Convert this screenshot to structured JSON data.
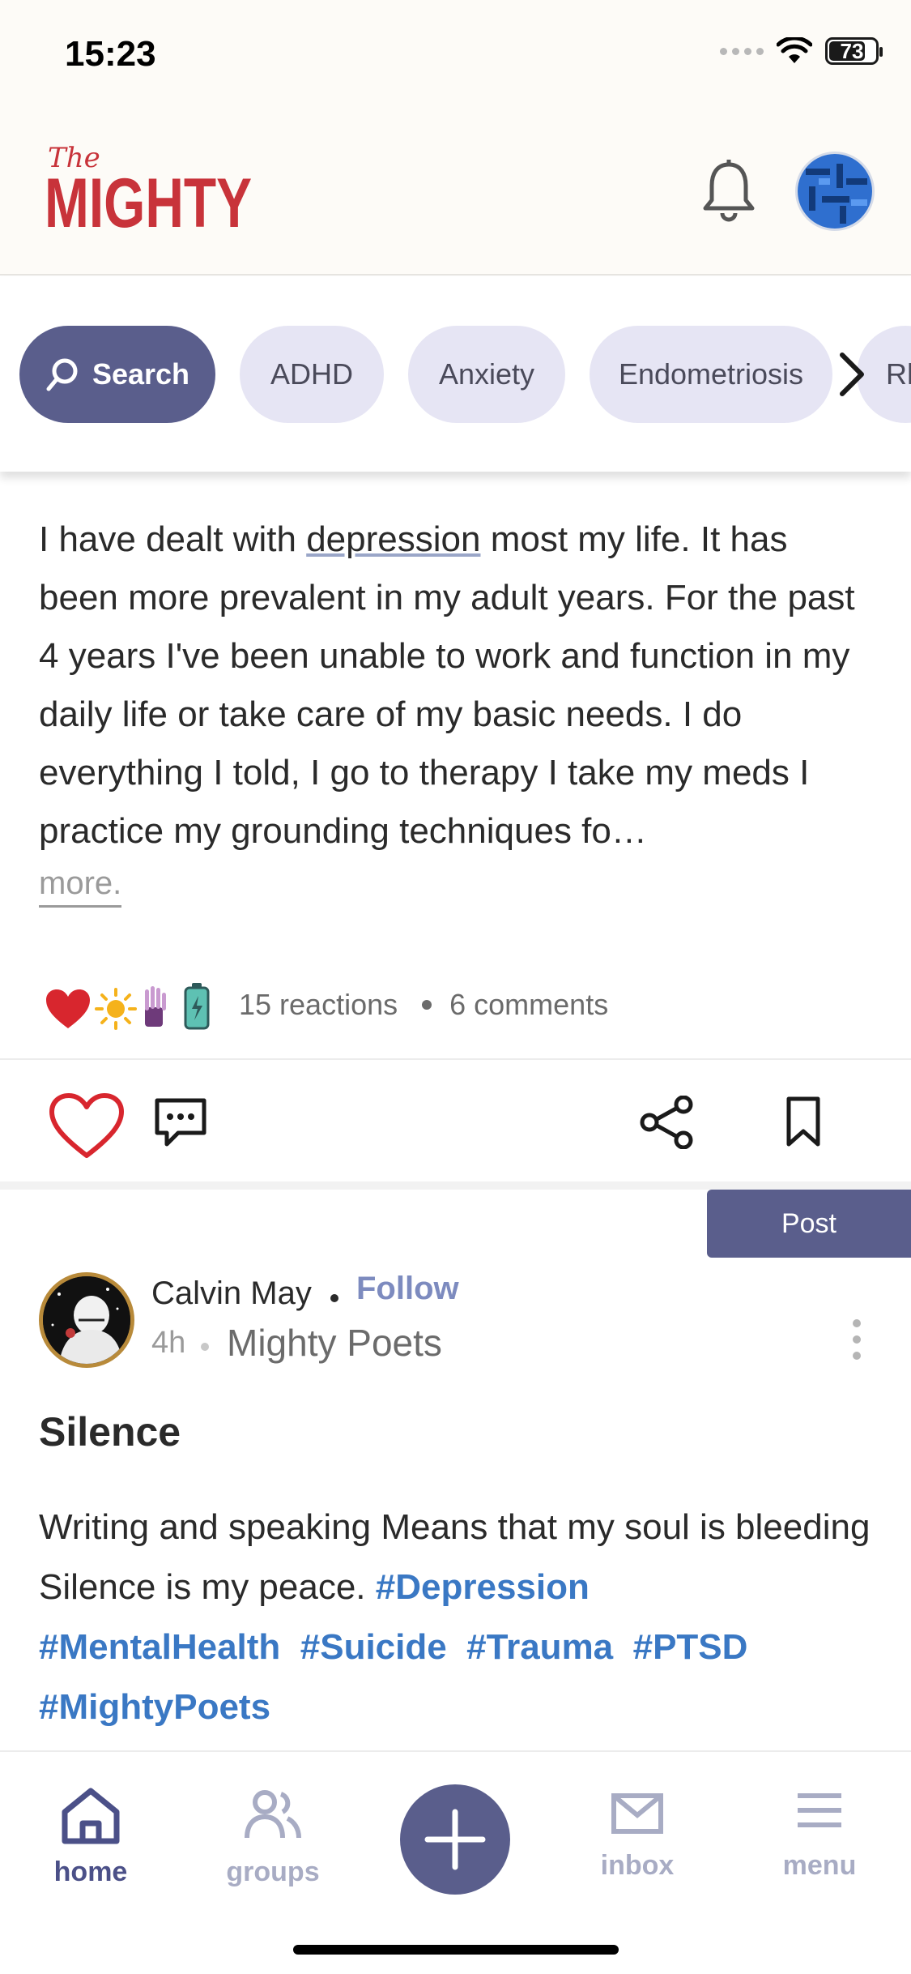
{
  "status_bar": {
    "time": "15:23",
    "battery": "73",
    "battery_level": 0.73
  },
  "header": {
    "logo_small": "The",
    "logo_main": "MIGHTY"
  },
  "chips": [
    {
      "label": "Search"
    },
    {
      "label": "ADHD"
    },
    {
      "label": "Anxiety"
    },
    {
      "label": "Endometriosis"
    },
    {
      "label": "Rh"
    }
  ],
  "post1": {
    "body_before_link": "I have dealt with ",
    "body_link": "depression",
    "body_after_link": " most my life. It has been more prevalent in my adult years. For the past 4 years I've been unable to work and function in my daily life or take care of my basic needs. I do everything I told, I go to therapy I take my meds I practice my grounding techniques fo…",
    "more": "more.",
    "reactions": "15 reactions",
    "comments": "6 comments"
  },
  "post_button": "Post",
  "post2": {
    "author": "Calvin May",
    "follow": "Follow",
    "time": "4h",
    "group": "Mighty Poets",
    "title": "Silence",
    "body": "Writing and speaking Means that my soul is bleeding Silence is my peace. ",
    "tags": [
      "#Depression",
      "#MentalHealth",
      "#Suicide",
      "#Trauma",
      "#PTSD",
      "#MightyPoets"
    ]
  },
  "tabs": [
    {
      "label": "home"
    },
    {
      "label": "groups"
    },
    {
      "label": "inbox"
    },
    {
      "label": "menu"
    }
  ],
  "colors": {
    "accent": "#5a5e8c",
    "brand_red": "#c8333a",
    "tag_blue": "#3a78c4",
    "chip_bg": "#e6e5f4"
  }
}
